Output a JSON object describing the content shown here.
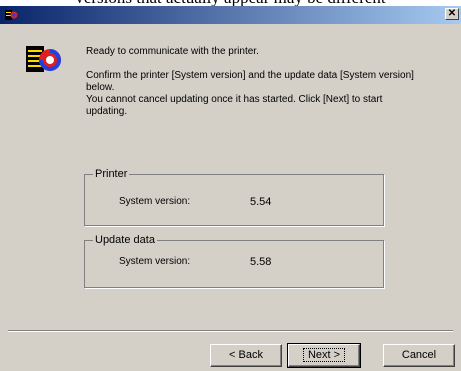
{
  "top_caption": "versions that actually appear may be different",
  "window": {
    "title": ""
  },
  "messages": {
    "ready": "Ready to communicate with the printer.",
    "confirm": "Confirm the printer [System version] and the update data [System version] below.",
    "cancel_note": "You cannot cancel updating once it has started. Click [Next] to start updating."
  },
  "printer_group": {
    "legend": "Printer",
    "label": "System version:",
    "value": "5.54"
  },
  "update_group": {
    "legend": "Update data",
    "label": "System version:",
    "value": "5.58"
  },
  "buttons": {
    "back": "< Back",
    "next": "Next >",
    "cancel": "Cancel"
  },
  "colors": {
    "dialog_bg": "#d4d0c8",
    "titlebar_start": "#0a246a",
    "titlebar_end": "#a6caf0"
  },
  "icons": {
    "app": "printer-update-icon",
    "wizard": "printer-refresh-icon",
    "close": "close-icon"
  }
}
